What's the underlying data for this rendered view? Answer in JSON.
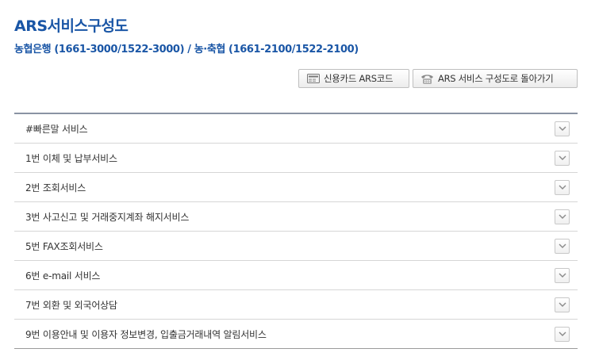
{
  "page": {
    "title": "ARS서비스구성도",
    "subtitle": "농협은행 (1661-3000/1522-3000) / 농·축협 (1661-2100/1522-2100)"
  },
  "buttons": {
    "credit_card_ars": {
      "label": "신용카드 ARS코드",
      "icon": "card-reader-icon"
    },
    "back_to_ars": {
      "label": "ARS 서비스 구성도로 돌아가기",
      "icon": "phone-icon"
    }
  },
  "menu": {
    "items": [
      {
        "label": "#빠른말 서비스"
      },
      {
        "label": "1번 이체 및 납부서비스"
      },
      {
        "label": "2번 조회서비스"
      },
      {
        "label": "3번 사고신고 및 거래중지계좌 해지서비스"
      },
      {
        "label": "5번 FAX조회서비스"
      },
      {
        "label": "6번 e-mail 서비스"
      },
      {
        "label": "7번 외환 및 외국어상담"
      },
      {
        "label": "9번 이용안내 및 이용자 정보변경, 입출금거래내역 알림서비스"
      }
    ],
    "expand_icon": "chevron-down-icon"
  },
  "colors": {
    "title": "#1a56a6",
    "list_top_border": "#8a93a3"
  }
}
